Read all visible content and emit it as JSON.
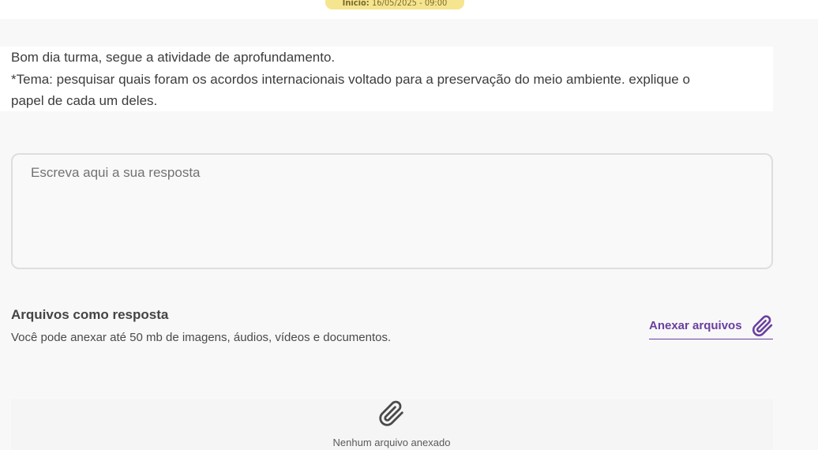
{
  "header": {
    "start_label": "Início:",
    "start_value": "16/05/2025 - 09:00"
  },
  "task": {
    "lines": [
      "Bom dia turma, segue a atividade de aprofundamento.",
      "*Tema: pesquisar quais foram os acordos internacionais voltado para a preservação do  meio ambiente. explique o",
      "papel de cada um deles."
    ]
  },
  "answer": {
    "placeholder": "Escreva aqui a sua resposta",
    "value": ""
  },
  "files": {
    "title": "Arquivos como resposta",
    "description": "Você pode anexar até 50 mb de imagens, áudios, vídeos e documentos.",
    "attach_label": "Anexar arquivos",
    "attach_icon": "paperclip-icon",
    "empty_icon": "paperclip-icon",
    "empty_text": "Nenhum arquivo anexado"
  },
  "colors": {
    "accent": "#6a3fa0",
    "badge": "#f6e58f",
    "empty_icon": "#4a4a4a"
  }
}
